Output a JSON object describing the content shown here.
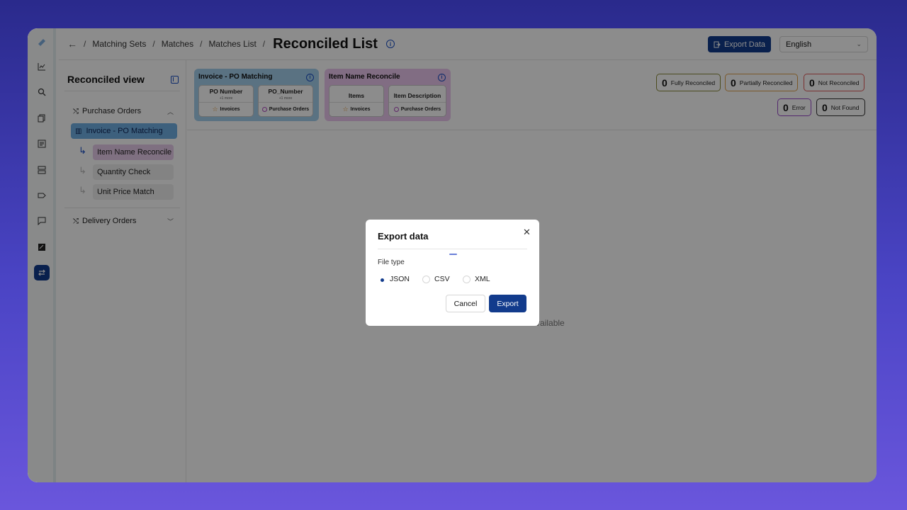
{
  "breadcrumb": {
    "items": [
      "Matching Sets",
      "Matches",
      "Matches List"
    ],
    "title": "Reconciled List"
  },
  "toolbar": {
    "export_label": "Export Data"
  },
  "language": {
    "selected": "English"
  },
  "sidebar": {
    "title": "Reconciled view",
    "groups": [
      {
        "label": "Purchase Orders"
      },
      {
        "label": "Delivery Orders"
      }
    ],
    "items": [
      {
        "label": "Invoice - PO Matching"
      },
      {
        "label": "Item Name Reconcile"
      },
      {
        "label": "Quantity Check"
      },
      {
        "label": "Unit Price Match"
      }
    ]
  },
  "cards": [
    {
      "title": "Invoice - PO Matching",
      "chips": [
        {
          "top": "PO Number",
          "more": "+1 more",
          "bottom": "Invoices"
        },
        {
          "top": "PO_Number",
          "more": "+1 more",
          "bottom": "Purchase Orders"
        }
      ]
    },
    {
      "title": "Item Name Reconcile",
      "chips": [
        {
          "top": "Items",
          "bottom": "Invoices"
        },
        {
          "top": "Item Description",
          "bottom": "Purchase Orders"
        }
      ]
    }
  ],
  "status": [
    {
      "count": "0",
      "label": "Fully Reconciled",
      "color": "#7a7a3a"
    },
    {
      "count": "0",
      "label": "Partially Reconciled",
      "color": "#d89a3a"
    },
    {
      "count": "0",
      "label": "Not Reconciled",
      "color": "#d84a4a"
    },
    {
      "count": "0",
      "label": "Error",
      "color": "#9a4ac8"
    },
    {
      "count": "0",
      "label": "Not Found",
      "color": "#333333"
    }
  ],
  "main": {
    "empty_text": "No data available"
  },
  "modal": {
    "title": "Export data",
    "file_type_label": "File type",
    "options": [
      "JSON",
      "CSV",
      "XML"
    ],
    "selected": "JSON",
    "cancel_label": "Cancel",
    "export_label": "Export"
  },
  "colors": {
    "accent": "#123b8c",
    "page_bg": "#4a44c4"
  }
}
